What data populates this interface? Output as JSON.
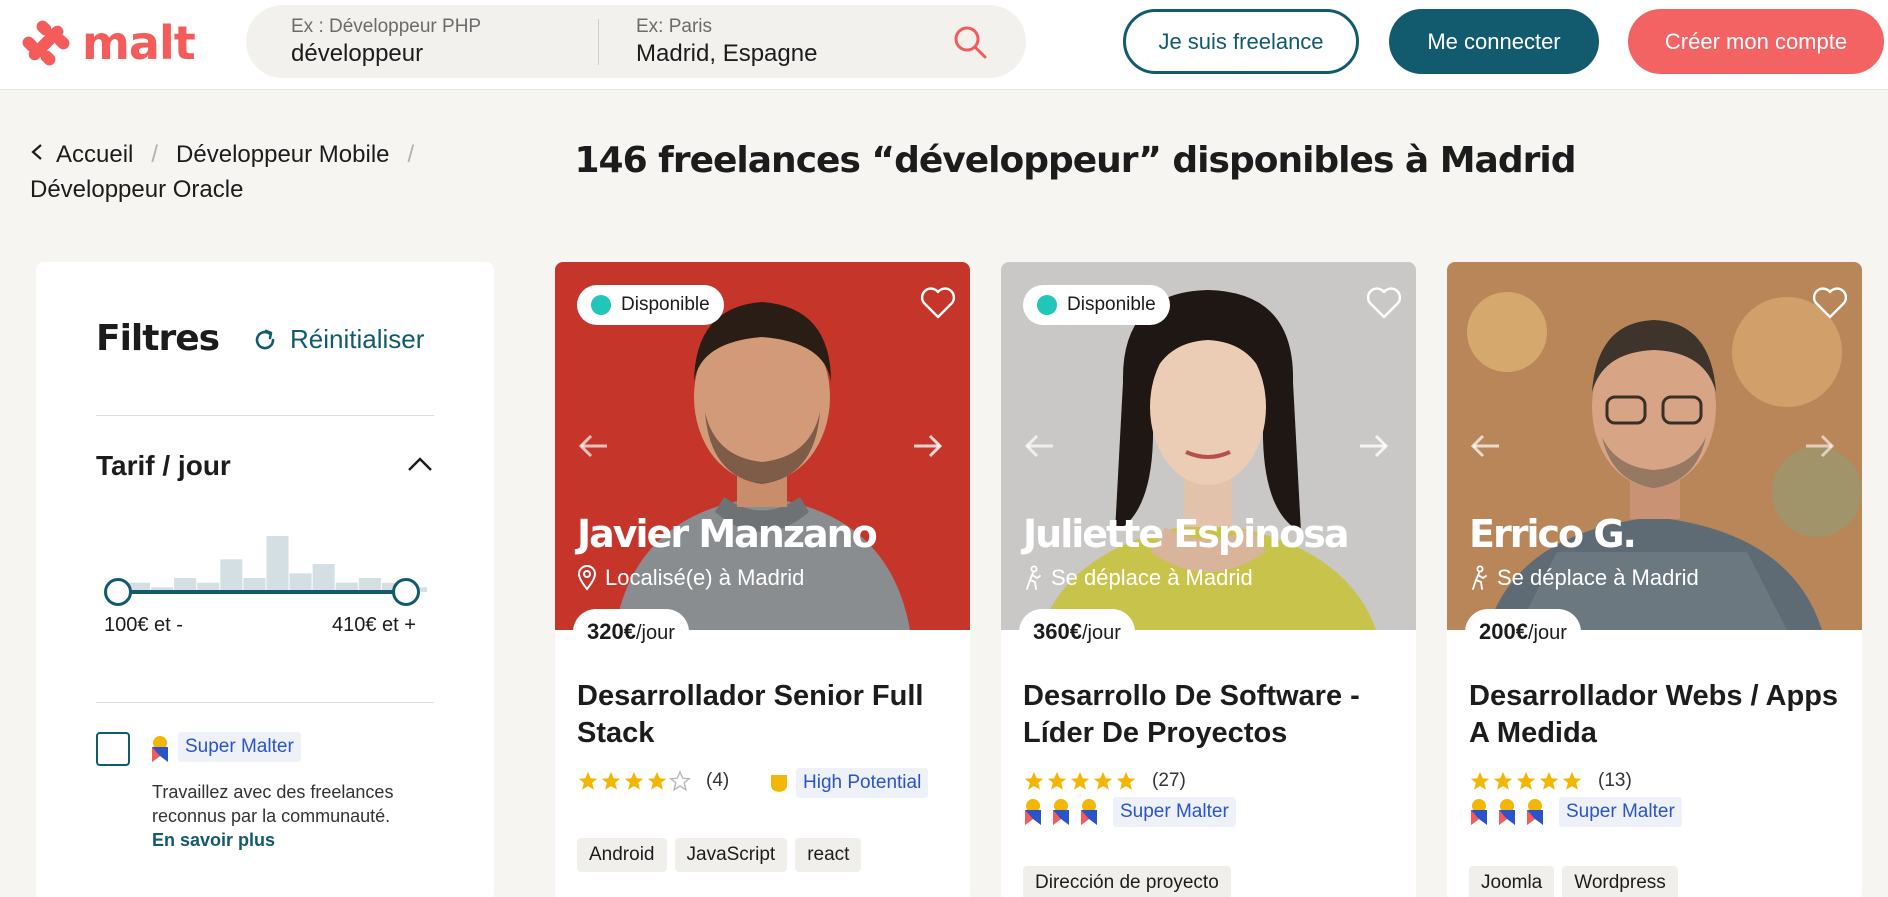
{
  "header": {
    "logo_text": "malt",
    "search": {
      "job_placeholder": "Ex : Développeur PHP",
      "job_value": "développeur",
      "location_placeholder": "Ex: Paris",
      "location_value": "Madrid, Espagne"
    },
    "buttons": {
      "freelance": "Je suis freelance",
      "login": "Me connecter",
      "signup": "Créer mon compte"
    }
  },
  "breadcrumb": [
    "Accueil",
    "Développeur Mobile",
    "Développeur Oracle"
  ],
  "title": "146 freelances “développeur” disponibles à Madrid",
  "filters": {
    "title": "Filtres",
    "reset": "Réinitialiser",
    "tarif_title": "Tarif / jour",
    "histogram": [
      2,
      1,
      3,
      2,
      7,
      3,
      12,
      4,
      6,
      2,
      3,
      2,
      1
    ],
    "min_label": "100€ et -",
    "max_label": "410€ et +",
    "super_malter_label": "Super Malter",
    "super_malter_desc": "Travaillez avec des freelances reconnus par la communauté.",
    "super_malter_link": "En savoir plus"
  },
  "cards": [
    {
      "available": "Disponible",
      "name": "Javier Manzano",
      "location": "Localisé(e) à Madrid",
      "price": "320€",
      "unit": "/jour",
      "title": "Desarrollador Senior Full Stack",
      "stars": 4,
      "reviews": "(4)",
      "badge": "High Potential",
      "tags": [
        "Android",
        "JavaScript",
        "react"
      ]
    },
    {
      "available": "Disponible",
      "name": "Juliette Espinosa",
      "location": "Se déplace à Madrid",
      "price": "360€",
      "unit": "/jour",
      "title": "Desarrollo De Software - Líder De Proyectos",
      "stars": 5,
      "reviews": "(27)",
      "badge": "Super Malter",
      "tags": [
        "Dirección de proyecto"
      ]
    },
    {
      "name": "Errico G.",
      "location": "Se déplace à Madrid",
      "price": "200€",
      "unit": "/jour",
      "title": "Desarrollador Webs / Apps A Medida",
      "stars": 5,
      "reviews": "(13)",
      "badge": "Super Malter",
      "tags": [
        "Joomla",
        "Wordpress"
      ]
    }
  ],
  "colors": {
    "brand": "#f45b5b",
    "primary": "#125a6e",
    "available_dot": "#20c6b7",
    "star": "#f2b705"
  }
}
